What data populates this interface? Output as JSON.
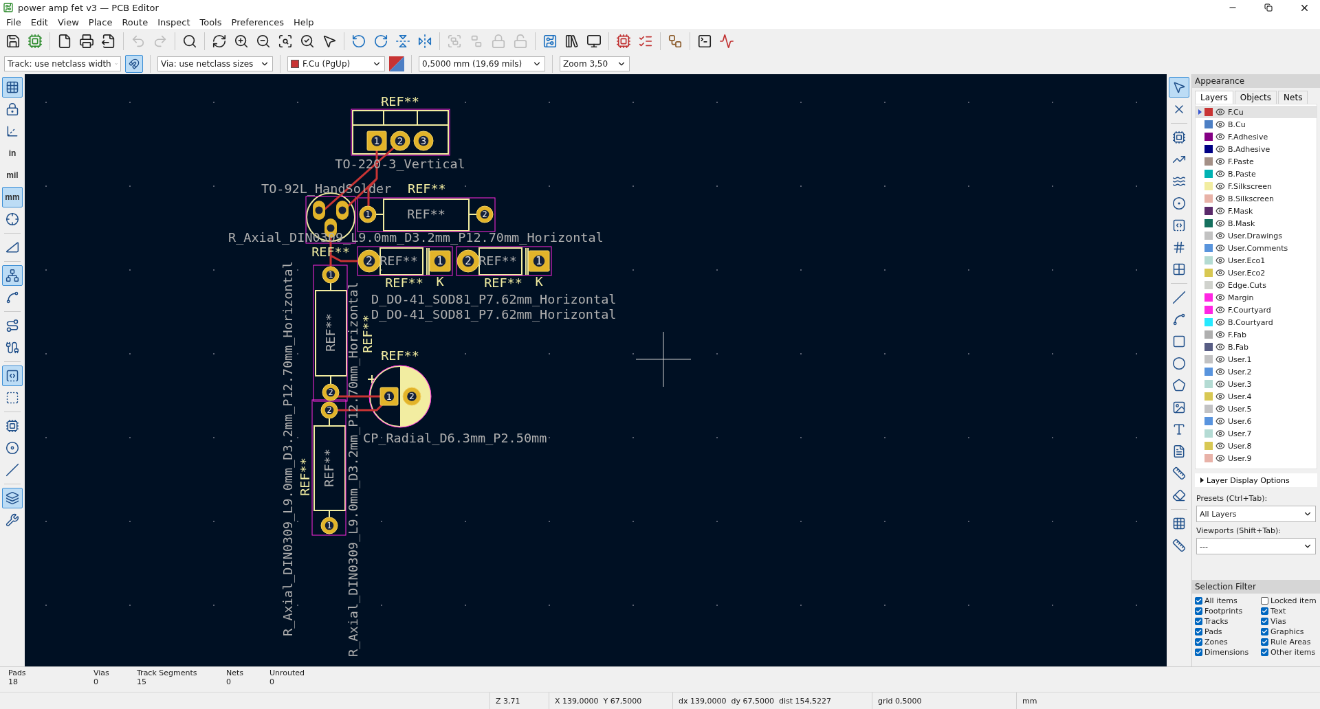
{
  "window": {
    "title": "power amp fet v3 — PCB Editor"
  },
  "menu": [
    "File",
    "Edit",
    "View",
    "Place",
    "Route",
    "Inspect",
    "Tools",
    "Preferences",
    "Help"
  ],
  "toolbar": [
    [
      {
        "disabled": false
      },
      {
        "disabled": false
      }
    ],
    [
      {
        "disabled": false
      },
      {
        "disabled": false
      },
      {
        "disabled": false
      }
    ],
    [
      {
        "disabled": true
      },
      {
        "disabled": true
      }
    ],
    [
      {
        "disabled": false
      }
    ],
    [
      {
        "disabled": false
      },
      {
        "disabled": false
      },
      {
        "disabled": false
      },
      {
        "disabled": false
      },
      {
        "disabled": false
      },
      {
        "disabled": false
      }
    ],
    [
      {
        "disabled": false
      },
      {
        "disabled": false
      },
      {
        "disabled": false
      },
      {
        "disabled": false
      }
    ],
    [
      {
        "disabled": true
      },
      {
        "disabled": true
      },
      {
        "disabled": true
      },
      {
        "disabled": true
      }
    ],
    [
      {
        "disabled": false
      },
      {
        "disabled": false
      },
      {
        "disabled": false
      }
    ],
    [
      {
        "disabled": false
      },
      {
        "disabled": false
      }
    ],
    [
      {
        "disabled": false
      }
    ],
    [
      {
        "disabled": false
      },
      {
        "disabled": false
      }
    ]
  ],
  "options_bar": {
    "track": "Track: use netclass width",
    "track_toggle_on": true,
    "via": "Via: use netclass sizes",
    "layer": {
      "label": "F.Cu (PgUp)",
      "color": "#c83434"
    },
    "grid": "0,5000 mm (19,69 mils)",
    "zoom": "Zoom 3,50"
  },
  "left_toolbar": [
    [
      {
        "on": true
      },
      {
        "on": false
      },
      {
        "on": false
      },
      {
        "on": false,
        "label": "in"
      },
      {
        "on": false,
        "label": "mil"
      },
      {
        "on": true,
        "label": "mm"
      },
      {
        "on": false
      }
    ],
    [
      {
        "on": false
      }
    ],
    [
      {
        "on": true
      },
      {
        "on": false
      }
    ],
    [
      {
        "on": false
      },
      {
        "on": false
      }
    ],
    [
      {
        "on": true
      },
      {
        "on": false
      }
    ],
    [
      {
        "on": false
      },
      {
        "on": false
      },
      {
        "on": false
      }
    ],
    [
      {
        "on": true
      },
      {
        "on": false
      }
    ]
  ],
  "right_toolbar": [
    [
      {
        "on": true
      },
      {
        "on": false
      }
    ],
    [
      {
        "on": false
      },
      {
        "on": false
      },
      {
        "on": false
      },
      {
        "on": false
      },
      {
        "on": false
      },
      {
        "on": false
      },
      {
        "on": false
      }
    ],
    [
      {
        "on": false
      },
      {
        "on": false
      },
      {
        "on": false
      },
      {
        "on": false
      },
      {
        "on": false
      },
      {
        "on": false
      },
      {
        "on": false
      },
      {
        "on": false
      },
      {
        "on": false
      },
      {
        "on": false
      }
    ],
    [
      {
        "on": false
      },
      {
        "on": false
      }
    ]
  ],
  "board": {
    "labels": [
      {
        "text": "REF**",
        "kind": "silkscreen"
      },
      {
        "text": "TO-220-3_Vertical",
        "kind": "fab"
      },
      {
        "text": "TO-92L_HandSolder",
        "kind": "fab"
      },
      {
        "text": "REF**",
        "kind": "silkscreen"
      },
      {
        "text": "REF**",
        "kind": "fab"
      },
      {
        "text": "R_Axial_DIN0309_L9.0mm_D3.2mm_P12.70mm_Horizontal",
        "kind": "fab"
      },
      {
        "text": "REF**",
        "kind": "silkscreen"
      },
      {
        "text": "REF**",
        "kind": "fab"
      },
      {
        "text": "REF**",
        "kind": "silkscreen"
      },
      {
        "text": "K",
        "kind": "silkscreen"
      },
      {
        "text": "REF**",
        "kind": "fab"
      },
      {
        "text": "REF**",
        "kind": "silkscreen"
      },
      {
        "text": "K",
        "kind": "silkscreen"
      },
      {
        "text": "D_DO-41_SOD81_P7.62mm_Horizontal",
        "kind": "fab"
      },
      {
        "text": "D_DO-41_SOD81_P7.62mm_Horizontal",
        "kind": "fab"
      },
      {
        "text": "R_Axial_DIN0309_L9.0mm_D3.2mm_P12.70mm_Horizontal",
        "kind": "fab"
      },
      {
        "text": "REF**",
        "kind": "fab"
      },
      {
        "text": "REF**",
        "kind": "silkscreen"
      },
      {
        "text": "R_Axial_DIN0309_L9.0mm_D3.2mm_P12.70mm_Horizontal",
        "kind": "fab"
      },
      {
        "text": "REF**",
        "kind": "silkscreen"
      },
      {
        "text": "CP_Radial_D6.3mm_P2.50mm",
        "kind": "fab"
      },
      {
        "text": "REF**",
        "kind": "fab"
      },
      {
        "text": "REF**",
        "kind": "silkscreen"
      }
    ],
    "pads": [
      {
        "kind": "square",
        "number": "1"
      },
      {
        "kind": "round",
        "number": "2"
      },
      {
        "kind": "round",
        "number": "3"
      },
      {
        "kind": "oval"
      },
      {
        "kind": "oval"
      },
      {
        "kind": "oval"
      },
      {
        "kind": "round",
        "number": "1"
      },
      {
        "kind": "round",
        "number": "2"
      },
      {
        "kind": "round",
        "number": "2"
      },
      {
        "kind": "square",
        "number": "1"
      },
      {
        "kind": "round",
        "number": "2"
      },
      {
        "kind": "square",
        "number": "1"
      },
      {
        "kind": "round",
        "number": "1"
      },
      {
        "kind": "round",
        "number": "2"
      },
      {
        "kind": "round",
        "number": "2"
      },
      {
        "kind": "round",
        "number": "1"
      },
      {
        "kind": "square",
        "number": "1"
      },
      {
        "kind": "round",
        "number": "2"
      }
    ]
  },
  "appearance": {
    "title": "Appearance",
    "tabs": [
      {
        "label": "Layers",
        "selected": true
      },
      {
        "label": "Objects",
        "selected": false
      },
      {
        "label": "Nets",
        "selected": false
      }
    ],
    "layers": [
      {
        "name": "F.Cu",
        "color": "#c83434",
        "visible": true,
        "selected": true
      },
      {
        "name": "B.Cu",
        "color": "#4d7fc4",
        "visible": true,
        "selected": false
      },
      {
        "name": "F.Adhesive",
        "color": "#840084",
        "visible": true,
        "selected": false
      },
      {
        "name": "B.Adhesive",
        "color": "#000084",
        "visible": true,
        "selected": false
      },
      {
        "name": "F.Paste",
        "color": "#a49087",
        "visible": true,
        "selected": false
      },
      {
        "name": "B.Paste",
        "color": "#00b2b2",
        "visible": true,
        "selected": false
      },
      {
        "name": "F.Silkscreen",
        "color": "#f2eda1",
        "visible": true,
        "selected": false
      },
      {
        "name": "B.Silkscreen",
        "color": "#e8b2a7",
        "visible": true,
        "selected": false
      },
      {
        "name": "F.Mask",
        "color": "#5a2a6a",
        "visible": true,
        "selected": false
      },
      {
        "name": "B.Mask",
        "color": "#15705e",
        "visible": true,
        "selected": false
      },
      {
        "name": "User.Drawings",
        "color": "#c2c2c2",
        "visible": true,
        "selected": false
      },
      {
        "name": "User.Comments",
        "color": "#5994dc",
        "visible": true,
        "selected": false
      },
      {
        "name": "User.Eco1",
        "color": "#b4dbd2",
        "visible": true,
        "selected": false
      },
      {
        "name": "User.Eco2",
        "color": "#d8c852",
        "visible": true,
        "selected": false
      },
      {
        "name": "Edge.Cuts",
        "color": "#d0d2cd",
        "visible": true,
        "selected": false
      },
      {
        "name": "Margin",
        "color": "#ff26e2",
        "visible": true,
        "selected": false
      },
      {
        "name": "F.Courtyard",
        "color": "#ff26e3",
        "visible": true,
        "selected": false
      },
      {
        "name": "B.Courtyard",
        "color": "#26e9ff",
        "visible": true,
        "selected": false
      },
      {
        "name": "F.Fab",
        "color": "#afafaf",
        "visible": true,
        "selected": false
      },
      {
        "name": "B.Fab",
        "color": "#585d84",
        "visible": true,
        "selected": false
      },
      {
        "name": "User.1",
        "color": "#c2c2c3",
        "visible": true,
        "selected": false
      },
      {
        "name": "User.2",
        "color": "#5994dd",
        "visible": true,
        "selected": false
      },
      {
        "name": "User.3",
        "color": "#b4dbd3",
        "visible": true,
        "selected": false
      },
      {
        "name": "User.4",
        "color": "#d8c853",
        "visible": true,
        "selected": false
      },
      {
        "name": "User.5",
        "color": "#c2c2c4",
        "visible": true,
        "selected": false
      },
      {
        "name": "User.6",
        "color": "#5994de",
        "visible": true,
        "selected": false
      },
      {
        "name": "User.7",
        "color": "#b4dbd4",
        "visible": true,
        "selected": false
      },
      {
        "name": "User.8",
        "color": "#d8c854",
        "visible": true,
        "selected": false
      },
      {
        "name": "User.9",
        "color": "#e8b2a8",
        "visible": true,
        "selected": false
      }
    ],
    "display_options": "Layer Display Options",
    "presets_label": "Presets (Ctrl+Tab):",
    "presets_value": "All Layers",
    "viewports_label": "Viewports (Shift+Tab):",
    "viewports_value": "---"
  },
  "selection_filter": {
    "title": "Selection Filter",
    "items": [
      {
        "label": "All items",
        "checked": true
      },
      {
        "label": "Locked item",
        "checked": false
      },
      {
        "label": "Footprints",
        "checked": true
      },
      {
        "label": "Text",
        "checked": true
      },
      {
        "label": "Tracks",
        "checked": true
      },
      {
        "label": "Vias",
        "checked": true
      },
      {
        "label": "Pads",
        "checked": true
      },
      {
        "label": "Graphics",
        "checked": true
      },
      {
        "label": "Zones",
        "checked": true
      },
      {
        "label": "Rule Areas",
        "checked": true
      },
      {
        "label": "Dimensions",
        "checked": true
      },
      {
        "label": "Other items",
        "checked": true
      }
    ]
  },
  "messages": [
    {
      "label": "Pads",
      "value": "18"
    },
    {
      "label": "Vias",
      "value": "0"
    },
    {
      "label": "Track Segments",
      "value": "15"
    },
    {
      "label": "Nets",
      "value": "0"
    },
    {
      "label": "Unrouted",
      "value": "0"
    }
  ],
  "status_bar": [
    "Z 3,71",
    "X 139,0000  Y 67,5000",
    "dx 139,0000  dy 67,5000  dist 154,5227",
    "grid 0,5000",
    "mm"
  ]
}
